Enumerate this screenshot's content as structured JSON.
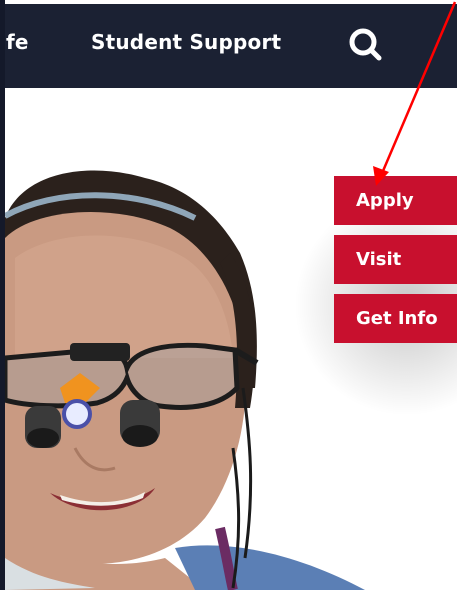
{
  "nav": {
    "partial_item": "fe",
    "student_support": "Student Support",
    "search_icon": "search-icon"
  },
  "cta": {
    "apply": "Apply",
    "visit": "Visit",
    "get_info": "Get Info"
  },
  "colors": {
    "nav_bg": "#1b2133",
    "cta_bg": "#c8102e",
    "annotation_arrow": "#ff0000"
  },
  "hero": {
    "image_alt": "dental hygiene student wearing loupes"
  }
}
